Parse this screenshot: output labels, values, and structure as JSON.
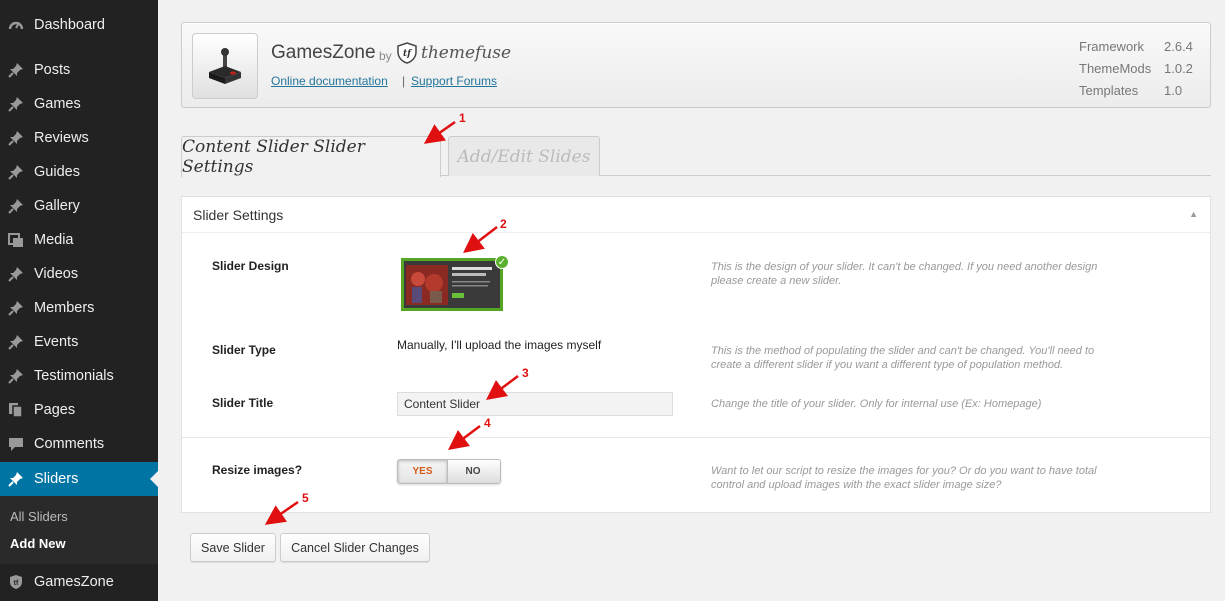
{
  "sidebar": {
    "items": [
      {
        "label": "Dashboard",
        "icon": "dashboard-icon"
      },
      {
        "label": "Posts",
        "icon": "pin-icon"
      },
      {
        "label": "Games",
        "icon": "pin-icon"
      },
      {
        "label": "Reviews",
        "icon": "pin-icon"
      },
      {
        "label": "Guides",
        "icon": "pin-icon"
      },
      {
        "label": "Gallery",
        "icon": "pin-icon"
      },
      {
        "label": "Media",
        "icon": "media-icon"
      },
      {
        "label": "Videos",
        "icon": "pin-icon"
      },
      {
        "label": "Members",
        "icon": "pin-icon"
      },
      {
        "label": "Events",
        "icon": "pin-icon"
      },
      {
        "label": "Testimonials",
        "icon": "pin-icon"
      },
      {
        "label": "Pages",
        "icon": "pages-icon"
      },
      {
        "label": "Comments",
        "icon": "comments-icon"
      },
      {
        "label": "Sliders",
        "icon": "pin-icon"
      },
      {
        "label": "GamesZone",
        "icon": "shield-icon"
      }
    ],
    "submenu": [
      {
        "label": "All Sliders"
      },
      {
        "label": "Add New"
      }
    ],
    "active_color": "#0074a2"
  },
  "header": {
    "theme_name": "GamesZone",
    "by": "by",
    "brand": "themefuse",
    "doc_link": "Online documentation",
    "separator": "|",
    "forum_link": "Support Forums",
    "versions": [
      {
        "label": "Framework",
        "value": "2.6.4"
      },
      {
        "label": "ThemeMods",
        "value": "1.0.2"
      },
      {
        "label": "Templates",
        "value": "1.0"
      }
    ]
  },
  "tabs": [
    {
      "label": "Content Slider Slider Settings",
      "active": true
    },
    {
      "label": "Add/Edit Slides",
      "active": false
    }
  ],
  "panel": {
    "title": "Slider Settings",
    "toggle_icon": "collapse-arrow-icon",
    "rows": {
      "design": {
        "label": "Slider Design",
        "desc": "This is the design of your slider. It can't be changed. If you need another design please create a new slider."
      },
      "type": {
        "label": "Slider Type",
        "value": "Manually, I'll upload the images myself",
        "desc": "This is the method of populating the slider and can't be changed. You'll need to create a different slider if you want a different type of population method."
      },
      "title": {
        "label": "Slider Title",
        "value": "Content Slider",
        "desc": "Change the title of your slider. Only for internal use (Ex: Homepage)"
      },
      "resize": {
        "label": "Resize images?",
        "yes": "YES",
        "no": "NO",
        "selected": "YES",
        "desc": "Want to let our script to resize the images for you? Or do you want to have total control and upload images with the exact slider image size?"
      }
    }
  },
  "buttons": {
    "save": "Save Slider",
    "cancel": "Cancel Slider Changes"
  },
  "annotations": [
    "1",
    "2",
    "3",
    "4",
    "5"
  ],
  "annotation_color": "#e01010"
}
